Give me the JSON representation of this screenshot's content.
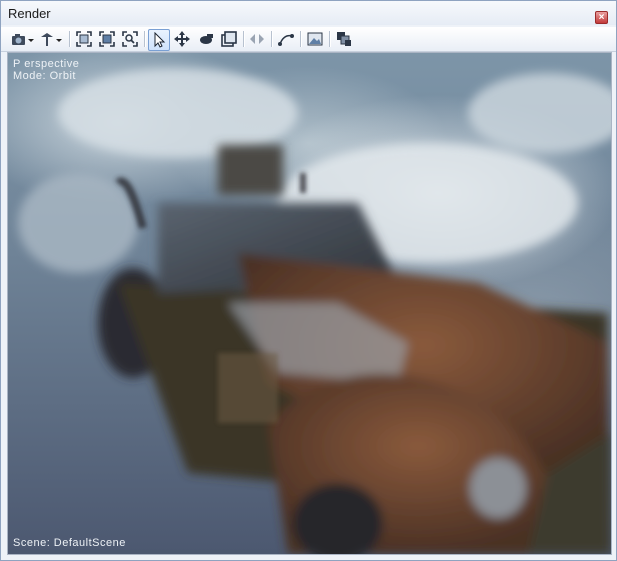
{
  "window": {
    "title": "Render",
    "close_glyph": "×"
  },
  "toolbar": {
    "buttons": [
      {
        "name": "camera-dropdown-button",
        "icon": "camera-icon"
      },
      {
        "name": "light-dropdown-button",
        "icon": "light-icon"
      },
      {
        "name": "fit-view-button",
        "icon": "frame-icon"
      },
      {
        "name": "fit-selection-button",
        "icon": "frame-selected-icon"
      },
      {
        "name": "zoom-extents-button",
        "icon": "zoom-extents-icon"
      },
      {
        "name": "select-tool-button",
        "icon": "cursor-icon"
      },
      {
        "name": "move-tool-button",
        "icon": "move-icon"
      },
      {
        "name": "rotate-tool-button",
        "icon": "rotate-icon"
      },
      {
        "name": "scale-tool-button",
        "icon": "scale-icon"
      },
      {
        "name": "snap-button",
        "icon": "snap-icon"
      },
      {
        "name": "path-button",
        "icon": "path-icon"
      },
      {
        "name": "image-button",
        "icon": "image-icon"
      },
      {
        "name": "layers-button",
        "icon": "layers-icon"
      }
    ]
  },
  "viewport": {
    "projection": "P erspective",
    "mode": "Mode: Orbit",
    "scene": "Scene: DefaultScene"
  },
  "colors": {
    "accent": "#7aa0d4",
    "close": "#c23a3a"
  }
}
